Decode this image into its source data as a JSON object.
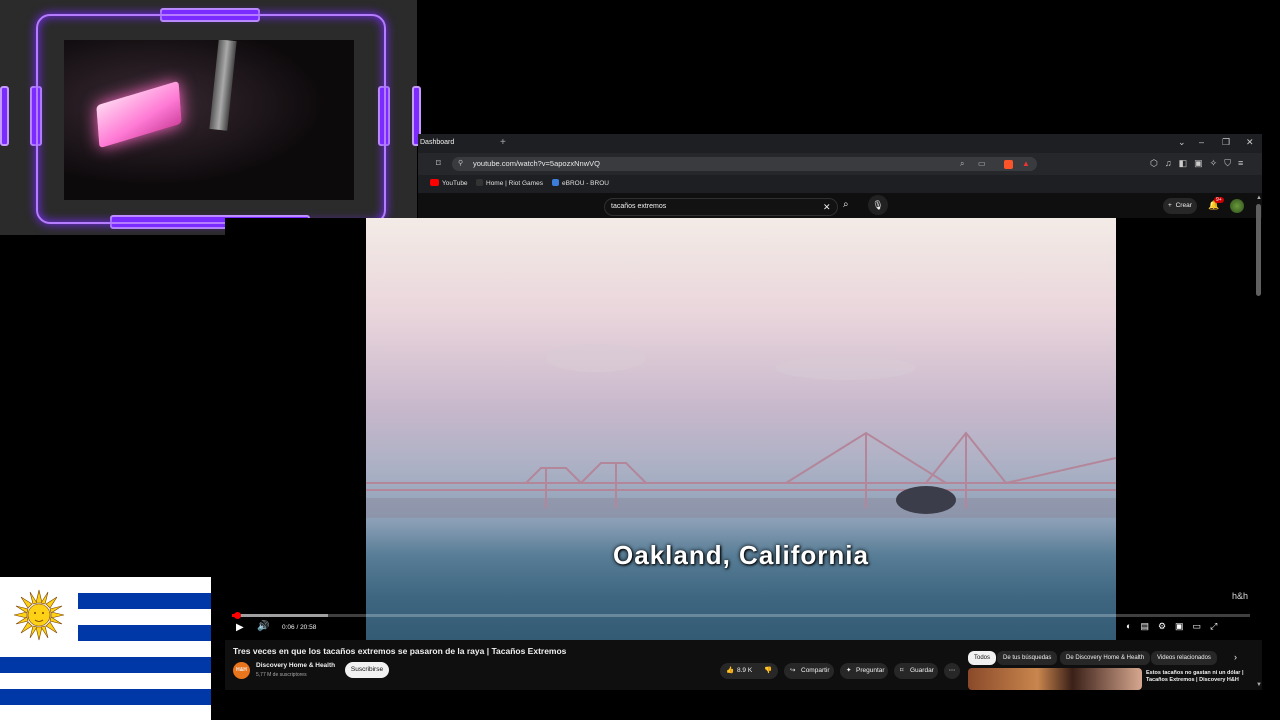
{
  "browser": {
    "tab_title": "Dashboard",
    "url": "youtube.com/watch?v=5apozxNnwVQ",
    "bookmarks": [
      "YouTube",
      "Home | Riot Games",
      "eBROU - BROU"
    ]
  },
  "youtube": {
    "search_query": "tacaños extremos",
    "create_label": "Crear",
    "notification_count": "9+",
    "video_overlay_text": "Oakland, California",
    "watermark": "h&h",
    "time_display": "0:06 / 20:58",
    "progress_fraction": 0.005,
    "title": "Tres veces en que los tacaños extremos se pasaron de la raya | Tacaños Extremos",
    "channel": {
      "name": "Discovery Home & Health",
      "subscribers": "5,77 M de suscriptores",
      "avatar_text": "H&H"
    },
    "subscribe_label": "Suscribirse",
    "likes": "8.9 K",
    "share_label": "Compartir",
    "ask_label": "Preguntar",
    "save_label": "Guardar",
    "chips": [
      "Todos",
      "De tus búsquedas",
      "De Discovery Home & Health",
      "Videos relacionados"
    ],
    "related_title": "Estos tacaños no gastan ni un dólar | Tacaños Extremos | Discovery H&H"
  },
  "colors": {
    "accent_red": "#ff0000",
    "cam_frame": "#b57cff",
    "flag_blue": "#0038a8",
    "sun_gold": "#fcd116"
  }
}
